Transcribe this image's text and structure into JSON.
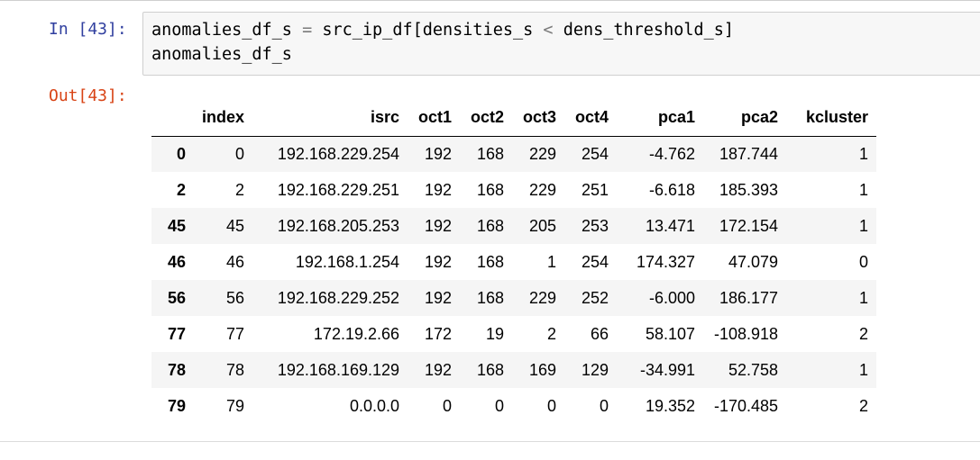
{
  "input_cell": {
    "prompt": "In [43]:",
    "code_line1_var": "anomalies_df_s",
    "code_line1_op": "=",
    "code_line1_expr_a": "src_ip_df[densities_s",
    "code_line1_cmp": "<",
    "code_line1_expr_b": "dens_threshold_s]",
    "code_line2": "anomalies_df_s"
  },
  "output_cell": {
    "prompt": "Out[43]:",
    "table": {
      "columns": [
        "index",
        "isrc",
        "oct1",
        "oct2",
        "oct3",
        "oct4",
        "pca1",
        "pca2",
        "kcluster"
      ],
      "rows": [
        {
          "label": "0",
          "cells": [
            "0",
            "192.168.229.254",
            "192",
            "168",
            "229",
            "254",
            "-4.762",
            "187.744",
            "1"
          ]
        },
        {
          "label": "2",
          "cells": [
            "2",
            "192.168.229.251",
            "192",
            "168",
            "229",
            "251",
            "-6.618",
            "185.393",
            "1"
          ]
        },
        {
          "label": "45",
          "cells": [
            "45",
            "192.168.205.253",
            "192",
            "168",
            "205",
            "253",
            "13.471",
            "172.154",
            "1"
          ]
        },
        {
          "label": "46",
          "cells": [
            "46",
            "192.168.1.254",
            "192",
            "168",
            "1",
            "254",
            "174.327",
            "47.079",
            "0"
          ]
        },
        {
          "label": "56",
          "cells": [
            "56",
            "192.168.229.252",
            "192",
            "168",
            "229",
            "252",
            "-6.000",
            "186.177",
            "1"
          ]
        },
        {
          "label": "77",
          "cells": [
            "77",
            "172.19.2.66",
            "172",
            "19",
            "2",
            "66",
            "58.107",
            "-108.918",
            "2"
          ]
        },
        {
          "label": "78",
          "cells": [
            "78",
            "192.168.169.129",
            "192",
            "168",
            "169",
            "129",
            "-34.991",
            "52.758",
            "1"
          ]
        },
        {
          "label": "79",
          "cells": [
            "79",
            "0.0.0.0",
            "0",
            "0",
            "0",
            "0",
            "19.352",
            "-170.485",
            "2"
          ]
        }
      ]
    }
  },
  "colors": {
    "in_prompt": "#303f9f",
    "out_prompt": "#d84315",
    "input_bg": "#f7f7f7",
    "row_stripe": "#f5f5f5"
  }
}
